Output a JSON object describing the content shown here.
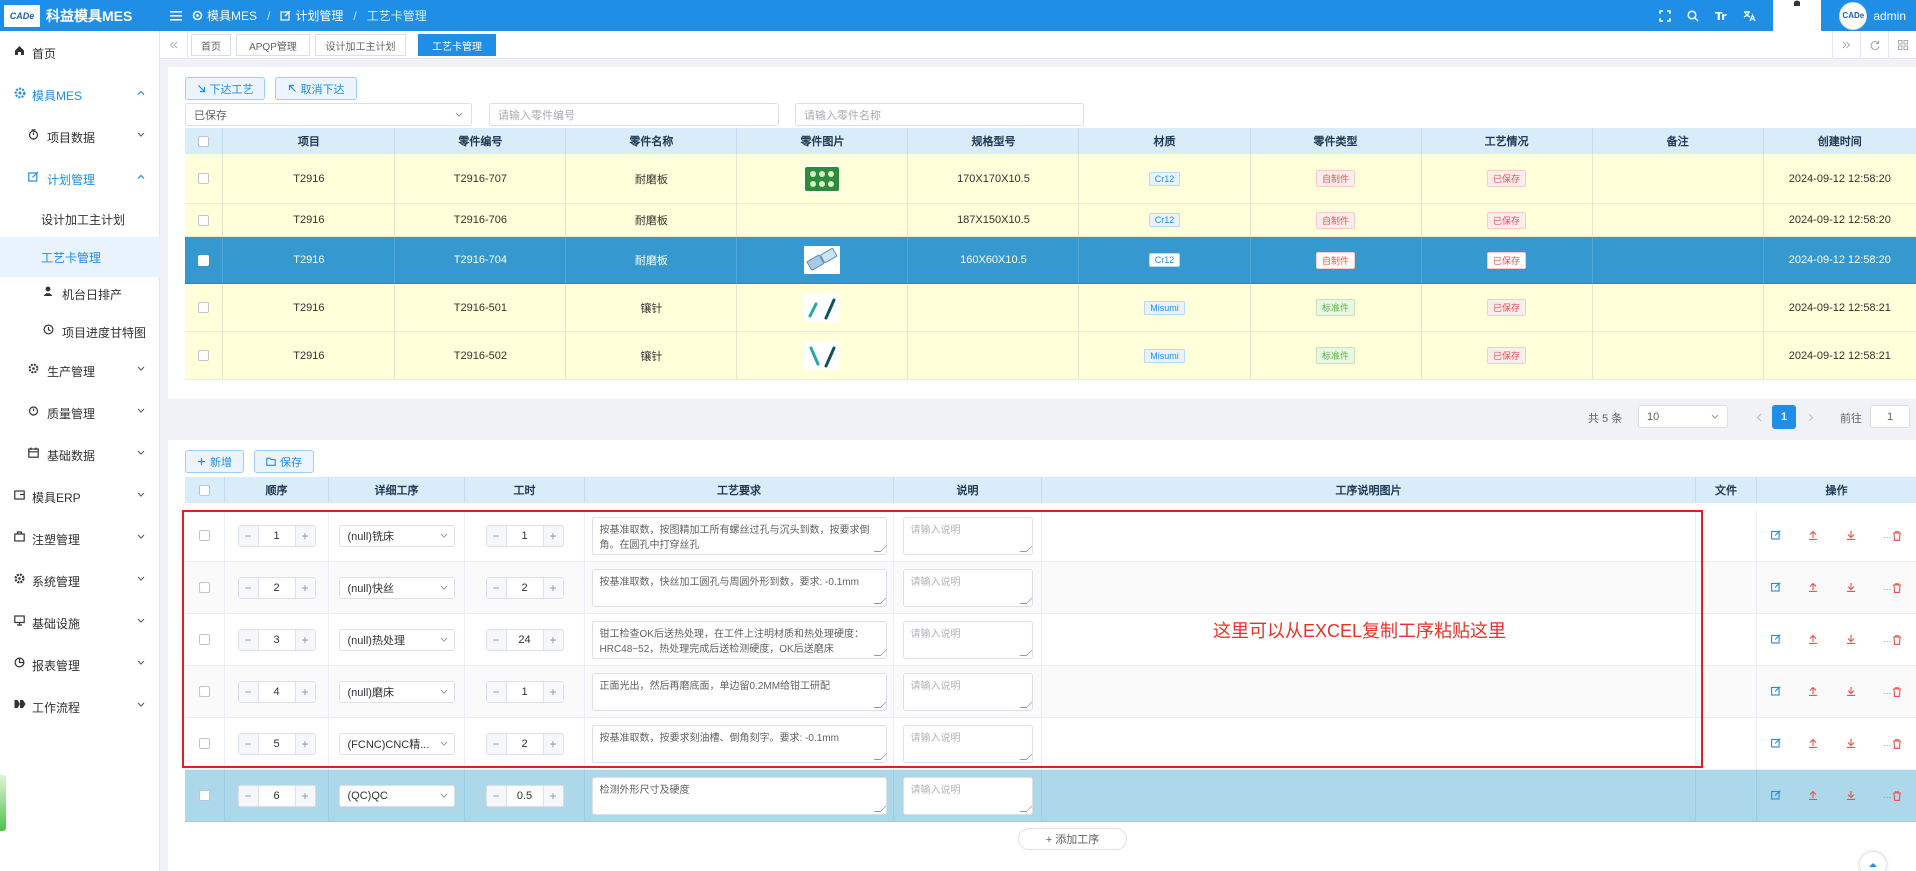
{
  "app": {
    "title": "科益模具MES",
    "logo_text": "CADe"
  },
  "breadcrumb": [
    "模具MES",
    "计划管理",
    "工艺卡管理"
  ],
  "user": {
    "name": "admin",
    "avatar_text": "CADe"
  },
  "sidebar": [
    {
      "label": "首页",
      "icon": "home-icon"
    },
    {
      "label": "模具MES",
      "icon": "gear-icon"
    },
    {
      "label": "项目数据",
      "icon": "timer-icon"
    },
    {
      "label": "计划管理",
      "icon": "edit-icon"
    },
    {
      "label": "设计加工主计划"
    },
    {
      "label": "工艺卡管理"
    },
    {
      "label": "机台日排产",
      "icon": "user-icon"
    },
    {
      "label": "项目进度甘特图",
      "icon": "clock-icon"
    },
    {
      "label": "生产管理",
      "icon": "gear-icon"
    },
    {
      "label": "质量管理",
      "icon": "stopwatch-icon"
    },
    {
      "label": "基础数据",
      "icon": "calendar-icon"
    },
    {
      "label": "模具ERP",
      "icon": "wallet-icon"
    },
    {
      "label": "注塑管理",
      "icon": "briefcase-icon"
    },
    {
      "label": "系统管理",
      "icon": "gear-icon"
    },
    {
      "label": "基础设施",
      "icon": "monitor-icon"
    },
    {
      "label": "报表管理",
      "icon": "pie-icon"
    },
    {
      "label": "工作流程",
      "icon": "flow-icon"
    }
  ],
  "tabs": [
    "首页",
    "APQP管理",
    "设计加工主计划",
    "工艺卡管理"
  ],
  "toolbar": {
    "issue": "下达工艺",
    "cancel": "取消下达"
  },
  "filters": {
    "status": "已保存",
    "part_no_ph": "请输入零件编号",
    "part_name_ph": "请输入零件名称"
  },
  "parts": {
    "headers": [
      "项目",
      "零件编号",
      "零件名称",
      "零件图片",
      "规格型号",
      "材质",
      "零件类型",
      "工艺情况",
      "备注",
      "创建时间"
    ],
    "rows": [
      {
        "project": "T2916",
        "part_no": "T2916-707",
        "name": "耐磨板",
        "spec": "170X170X10.5",
        "material": "Cr12",
        "type": "自制件",
        "status": "已保存",
        "remark": "",
        "created": "2024-09-12 12:58:20"
      },
      {
        "project": "T2916",
        "part_no": "T2916-706",
        "name": "耐磨板",
        "spec": "187X150X10.5",
        "material": "Cr12",
        "type": "自制件",
        "status": "已保存",
        "remark": "",
        "created": "2024-09-12 12:58:20"
      },
      {
        "project": "T2916",
        "part_no": "T2916-704",
        "name": "耐磨板",
        "spec": "160X60X10.5",
        "material": "Cr12",
        "type": "自制件",
        "status": "已保存",
        "remark": "",
        "created": "2024-09-12 12:58:20"
      },
      {
        "project": "T2916",
        "part_no": "T2916-501",
        "name": "镶针",
        "spec": "",
        "material": "Misumi",
        "type": "标准件",
        "status": "已保存",
        "remark": "",
        "created": "2024-09-12 12:58:21"
      },
      {
        "project": "T2916",
        "part_no": "T2916-502",
        "name": "镶针",
        "spec": "",
        "material": "Misumi",
        "type": "标准件",
        "status": "已保存",
        "remark": "",
        "created": "2024-09-12 12:58:21"
      }
    ]
  },
  "pagination": {
    "total": "共 5 条",
    "page_size": "10",
    "current": "1",
    "goto_label": "前往",
    "goto_value": "1"
  },
  "process_toolbar": {
    "add": "新增",
    "save": "保存"
  },
  "process": {
    "headers": [
      "顺序",
      "详细工序",
      "工时",
      "工艺要求",
      "说明",
      "工序说明图片",
      "文件",
      "操作"
    ],
    "desc_placeholder": "请输入说明",
    "rows": [
      {
        "seq": "1",
        "op": "(null)铣床",
        "hours": "1",
        "req": "按基准取数，按图精加工所有螺丝过孔与沉头到数，按要求倒角。在圆孔中打穿丝孔"
      },
      {
        "seq": "2",
        "op": "(null)快丝",
        "hours": "2",
        "req": "按基准取数，快丝加工圆孔与周圆外形到数，要求: -0.1mm"
      },
      {
        "seq": "3",
        "op": "(null)热处理",
        "hours": "24",
        "req": "钳工检查OK后送热处理，在工件上注明材质和热处理硬度：HRC48~52，热处理完成后送检测硬度，OK后送磨床"
      },
      {
        "seq": "4",
        "op": "(null)磨床",
        "hours": "1",
        "req": "正面光出，然后再磨底面，单边留0.2MM给钳工研配"
      },
      {
        "seq": "5",
        "op": "(FCNC)CNC精...",
        "hours": "2",
        "req": "按基准取数，按要求刻油槽、倒角刻字。要求: -0.1mm"
      },
      {
        "seq": "6",
        "op": "(QC)QC",
        "hours": "0.5",
        "req": "检测外形尺寸及硬度"
      }
    ],
    "add_row": "+ 添加工序"
  },
  "annotation": "这里可以从EXCEL复制工序粘贴这里",
  "colors": {
    "primary": "#1f8ee6",
    "highlight_row": "#3598cf",
    "yellow_row": "#ffffd9",
    "annotation": "#e6332a"
  }
}
